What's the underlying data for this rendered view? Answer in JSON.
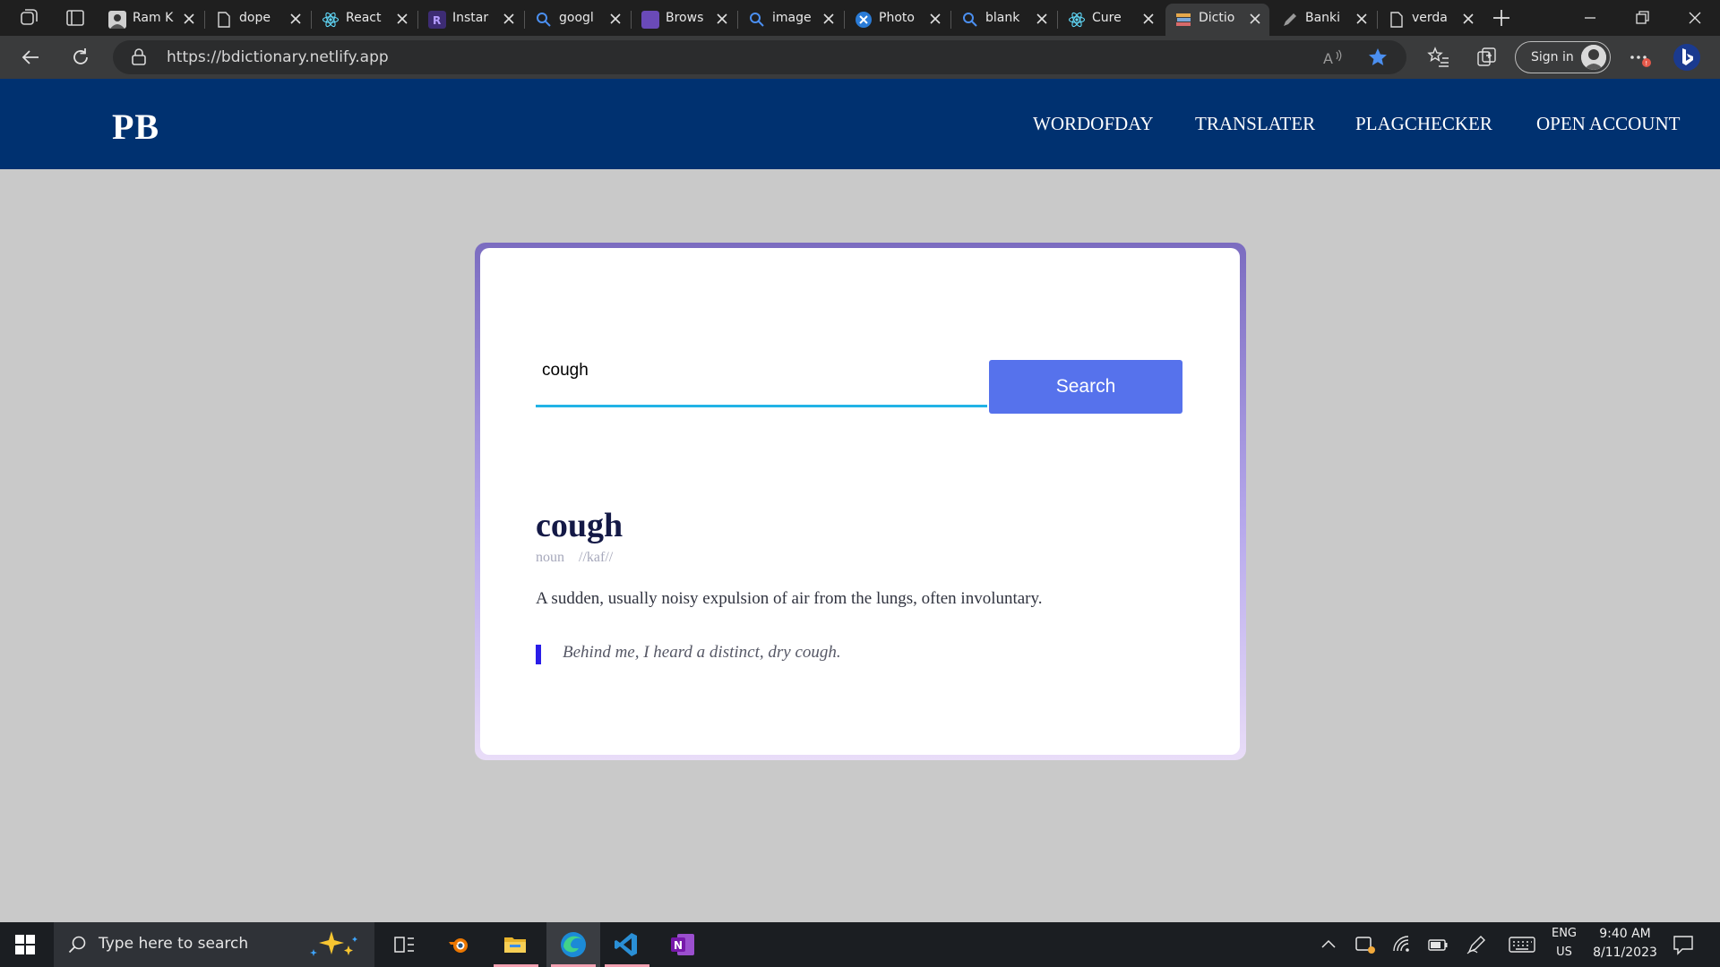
{
  "browser": {
    "tabs": [
      {
        "title": "Ram K",
        "icon": "avatar-favicon"
      },
      {
        "title": "dope",
        "icon": "page-icon"
      },
      {
        "title": "React",
        "icon": "react-icon"
      },
      {
        "title": "Instar",
        "icon": "r-logo-icon"
      },
      {
        "title": "googl",
        "icon": "search-icon"
      },
      {
        "title": "Brows",
        "icon": "colorful-logo-icon"
      },
      {
        "title": "image",
        "icon": "search-icon"
      },
      {
        "title": "Photo",
        "icon": "photo-app-icon"
      },
      {
        "title": "blank",
        "icon": "search-icon"
      },
      {
        "title": "Cure",
        "icon": "react-icon"
      },
      {
        "title": "Dictio",
        "icon": "books-icon",
        "active": true
      },
      {
        "title": "Banki",
        "icon": "pencil-icon"
      },
      {
        "title": "verda",
        "icon": "doc-icon"
      }
    ],
    "url": "https://bdictionary.netlify.app",
    "sign_in_label": "Sign in"
  },
  "site": {
    "logo": "PB",
    "nav": [
      "WORDOFDAY",
      "TRANSLATER",
      "PLAGCHECKER",
      "OPEN ACCOUNT"
    ]
  },
  "dictionary": {
    "search_value": "cough",
    "search_button": "Search",
    "word": "cough",
    "part_of_speech": "noun",
    "phonetic": "//kaf//",
    "definition": "A sudden, usually noisy expulsion of air from the lungs, often involuntary.",
    "example": "Behind me, I heard a distinct, dry cough."
  },
  "taskbar": {
    "search_placeholder": "Type here to search",
    "language": "ENG",
    "region": "US",
    "time": "9:40 AM",
    "date": "8/11/2023"
  },
  "colors": {
    "navbar": "#003170",
    "page_bg": "#c9c9c9",
    "search_button": "#5672ec",
    "input_underline": "#22b3e6",
    "word": "#141946",
    "quote_bar": "#2a1de8"
  }
}
